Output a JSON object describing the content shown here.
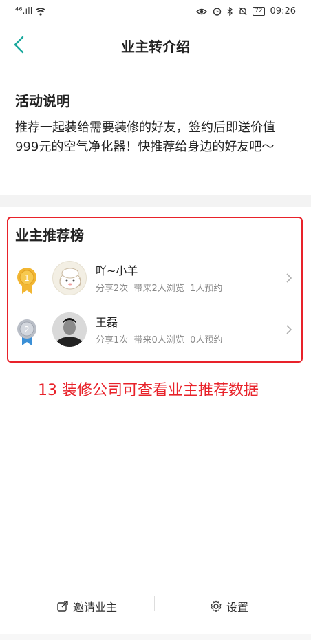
{
  "status": {
    "signal_label": "⁴⁶.ıll",
    "battery": "72",
    "time": "09:26"
  },
  "header": {
    "title": "业主转介绍"
  },
  "activity": {
    "title": "活动说明",
    "description": "推荐一起装给需要装修的好友，签约后即送价值999元的空气净化器！快推荐给身边的好友吧～"
  },
  "ranking": {
    "title": "业主推荐榜",
    "items": [
      {
        "rank": "1",
        "name": "吖~小羊",
        "stats": "分享2次  带来2人浏览  1人预约",
        "medal_color": "#f2b632"
      },
      {
        "rank": "2",
        "name": "王磊",
        "stats": "分享1次  带来0人浏览  0人预约",
        "medal_color": "#b9bec7"
      }
    ]
  },
  "annotation": {
    "text": "13  装修公司可查看业主推荐数据"
  },
  "footer": {
    "invite_label": "邀请业主",
    "settings_label": "设置"
  },
  "colors": {
    "accent": "#19a89d",
    "highlight": "#e8222a"
  }
}
